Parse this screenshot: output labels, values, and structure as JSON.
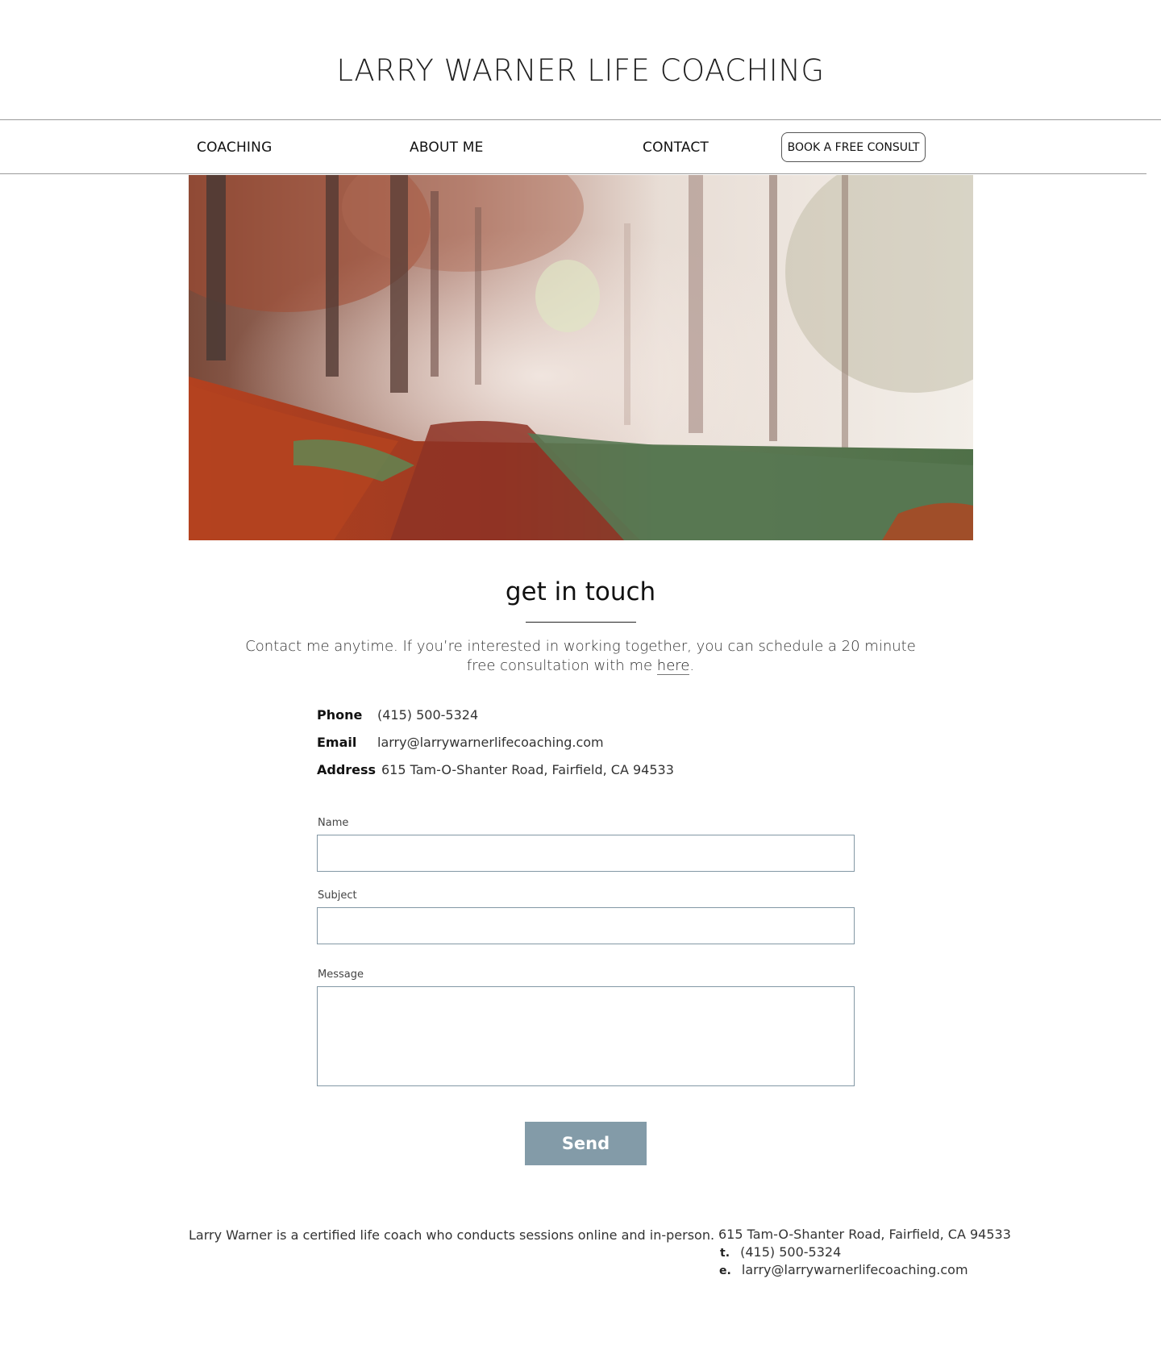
{
  "header": {
    "site_title": "LARRY WARNER LIFE COACHING"
  },
  "nav": {
    "items": [
      {
        "label": "COACHING"
      },
      {
        "label": "ABOUT ME"
      },
      {
        "label": "CONTACT"
      }
    ],
    "cta_label": "BOOK A FREE CONSULT"
  },
  "hero": {
    "image": "autumn-forest-path-photo"
  },
  "contact": {
    "heading": "get in touch",
    "intro_text": "Contact me anytime. If you’re interested in working together, you can schedule a 20 minute free consultation with me ",
    "intro_link": "here",
    "intro_end": ".",
    "phone_label": "Phone",
    "phone_value": "(415) 500-5324",
    "email_label": "Email",
    "email_value": "larry@larrywarnerlifecoaching.com",
    "address_label": "Address",
    "address_value": "615 Tam-O-Shanter Road, Fairfield, CA 94533"
  },
  "form": {
    "name_label": "Name",
    "name_value": "",
    "subject_label": "Subject",
    "subject_value": "",
    "message_label": "Message",
    "message_value": "",
    "send_label": "Send"
  },
  "footer": {
    "about_text": "Larry Warner is a certified life coach who conducts sessions online and in-person.",
    "address": "615 Tam-O-Shanter Road, Fairfield, CA 94533",
    "phone_prefix": "t.",
    "phone": "(415) 500-5324",
    "email_prefix": "e.",
    "email": "larry@larrywarnerlifecoaching.com"
  },
  "colors": {
    "send_button": "#839ba8",
    "field_border": "#8398a5",
    "divider": "#9a9a9a"
  }
}
